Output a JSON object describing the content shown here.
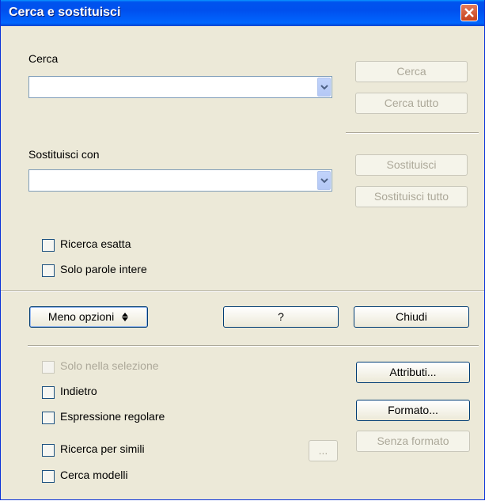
{
  "window": {
    "title": "Cerca e sostituisci"
  },
  "search": {
    "label": "Cerca",
    "value": ""
  },
  "replace": {
    "label": "Sostituisci con",
    "value": ""
  },
  "buttons": {
    "search": "Cerca",
    "search_all": "Cerca tutto",
    "replace": "Sostituisci",
    "replace_all": "Sostituisci tutto",
    "fewer_options": "Meno opzioni",
    "help": "?",
    "close": "Chiudi",
    "attributes": "Attributi...",
    "format": "Formato...",
    "no_format": "Senza formato",
    "similarity_options": "..."
  },
  "options": {
    "match_case": "Ricerca esatta",
    "whole_words": "Solo parole intere",
    "current_selection": "Solo nella selezione",
    "backwards": "Indietro",
    "regex": "Espressione regolare",
    "similarity": "Ricerca per simili",
    "styles": "Cerca modelli"
  }
}
